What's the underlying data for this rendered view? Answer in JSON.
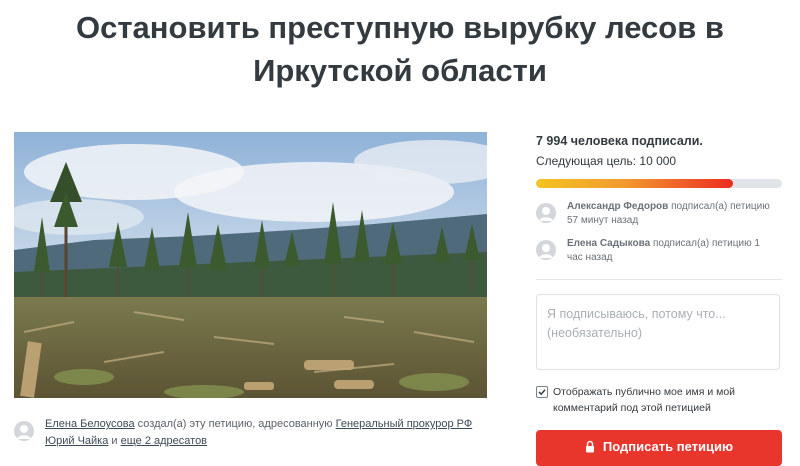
{
  "petition": {
    "title": "Остановить преступную вырубку лесов в Иркутской области"
  },
  "creator": {
    "name": "Елена Белоусова",
    "text_created": " создал(а) эту петицию, адресованную ",
    "target": "Генеральный прокурор РФ Юрий Чайка",
    "text_and": " и ",
    "others": "еще 2 адресатов"
  },
  "stats": {
    "signed": "7 994 человека подписали.",
    "next_goal": "Следующая цель: 10 000",
    "progress_fraction": 0.7994
  },
  "recent_signers": [
    {
      "name": "Александр Федоров",
      "action": " подписал(а) петицию",
      "time": "57 минут назад"
    },
    {
      "name": "Елена Садыкова",
      "action": " подписал(а) петицию 1",
      "time": "час назад"
    }
  ],
  "form": {
    "comment_placeholder": "Я подписываюсь, потому что... (необязательно)",
    "comment_value": "",
    "public_checkbox_label": "Отображать публично мое имя и мой комментарий под этой петицией",
    "public_checked": true,
    "sign_button_label": "Подписать петицию"
  },
  "colors": {
    "accent_red": "#e8362d",
    "progress_start": "#f5c321",
    "progress_end": "#ec2c22",
    "heading": "#333a40"
  },
  "icons": {
    "avatar": "user-avatar-icon",
    "checkbox": "checkmark-icon",
    "button": "lock-icon"
  }
}
